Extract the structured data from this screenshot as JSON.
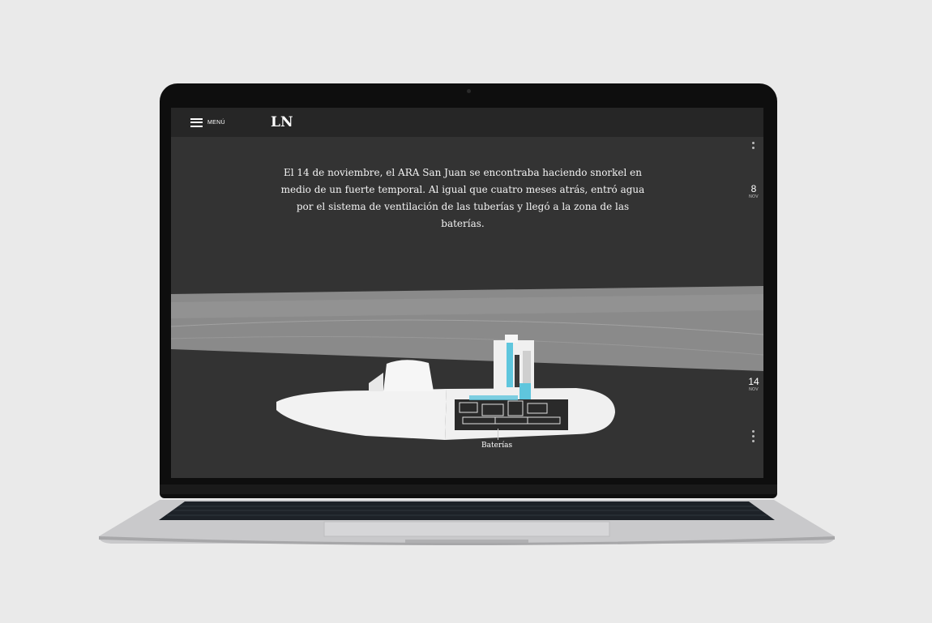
{
  "header": {
    "menu_label": "MENÚ",
    "logo": "LN"
  },
  "story": {
    "text": "El 14 de noviembre, el ARA San Juan se encontraba haciendo snorkel en medio de un fuerte temporal. Al igual que cuatro meses atrás, entró agua por el sistema de ventilación de las tuberías y llegó a la zona de las baterías."
  },
  "scene": {
    "label": "Baterías"
  },
  "timeline": [
    {
      "day": "8",
      "month": "NOV"
    },
    {
      "day": "14",
      "month": "NOV"
    }
  ],
  "icons": [
    "hamburger-menu-icon"
  ],
  "colors": {
    "screen_bg": "#333333",
    "topbar_bg": "#262626",
    "accent_cyan": "#5fc6dd"
  }
}
